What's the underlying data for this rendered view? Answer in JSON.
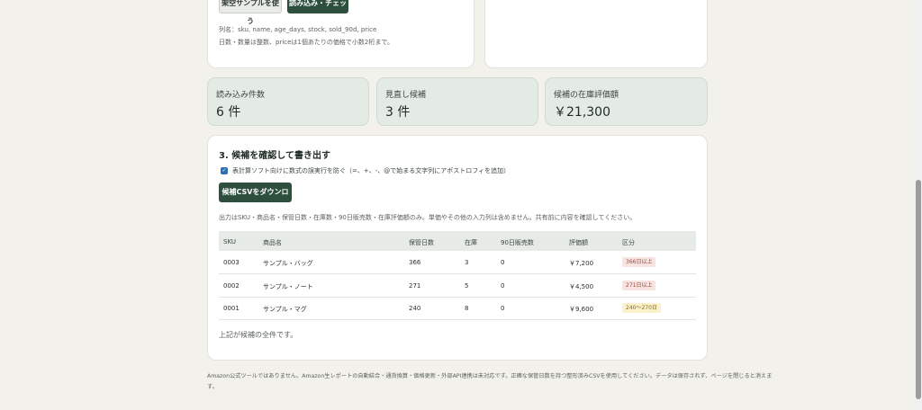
{
  "top": {
    "sample_button": "架空サンプルを使う",
    "load_button": "読み込み・チェック",
    "note1": "列名：sku, name, age_days, stock, sold_90d, price",
    "note2": "日数・数量は整数、priceは1個あたりの価格で小数2桁まで。"
  },
  "stats": [
    {
      "label": "読み込み件数",
      "value": "6 件"
    },
    {
      "label": "見直し候補",
      "value": "3 件"
    },
    {
      "label": "候補の在庫評価額",
      "value": "￥21,300"
    }
  ],
  "section": {
    "title": "3. 候補を確認して書き出す",
    "checkbox_label": "表計算ソフト向けに数式の誤実行を防ぐ（=、+、-、@で始まる文字列にアポストロフィを追加）",
    "checkbox_checked": true,
    "download_button": "候補CSVをダウンロード",
    "output_note": "出力はSKU・商品名・保管日数・在庫数・90日販売数・在庫評価額のみ。単価やその他の入力列は含めません。共有前に内容を確認してください。",
    "footer_note": "上記が候補の全件です。"
  },
  "table": {
    "headers": [
      "SKU",
      "商品名",
      "保管日数",
      "在庫",
      "90日販売数",
      "評価額",
      "区分"
    ],
    "rows": [
      {
        "sku": "0003",
        "name": "サンプル・バッグ",
        "days": "366",
        "stock": "3",
        "sold": "0",
        "value": "￥7,200",
        "tag": "366日以上",
        "tag_kind": "red"
      },
      {
        "sku": "0002",
        "name": "サンプル・ノート",
        "days": "271",
        "stock": "5",
        "sold": "0",
        "value": "￥4,500",
        "tag": "271日以上",
        "tag_kind": "red"
      },
      {
        "sku": "0001",
        "name": "サンプル・マグ",
        "days": "240",
        "stock": "8",
        "sold": "0",
        "value": "￥9,600",
        "tag": "240〜270日",
        "tag_kind": "yellow"
      }
    ]
  },
  "disclaimer": {
    "line1": "Amazon公式ツールではありません。Amazon生レポートの自動結合・通貨換算・価格更新・外部API連携は未対応です。正確な保管日数を持つ整形済みCSVを使用してください。データは保存されず、ページを閉じると消えま",
    "line2": "す。"
  },
  "colors": {
    "accent": "#2f4f3e",
    "stat_bg": "#e4ebe5",
    "page_bg": "#f3f1ec"
  }
}
